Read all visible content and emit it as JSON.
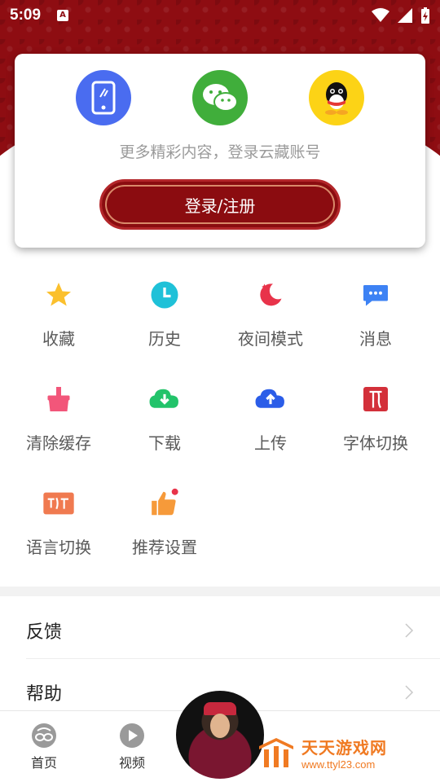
{
  "status_bar": {
    "time": "5:09",
    "app_badge": "A"
  },
  "login": {
    "hint": "更多精彩内容，登录云藏账号",
    "button_label": "登录/注册",
    "methods": [
      "phone-icon",
      "wechat-icon",
      "qq-icon"
    ]
  },
  "grid": [
    {
      "label": "收藏",
      "icon": "star-icon",
      "color": "#fbc02d"
    },
    {
      "label": "历史",
      "icon": "clock-icon",
      "color": "#1fc1d8"
    },
    {
      "label": "夜间模式",
      "icon": "moon-icon",
      "color": "#e8334a"
    },
    {
      "label": "消息",
      "icon": "message-icon",
      "color": "#3d82f4"
    },
    {
      "label": "清除缓存",
      "icon": "broom-icon",
      "color": "#f2567a"
    },
    {
      "label": "下载",
      "icon": "cloud-download-icon",
      "color": "#22c36a"
    },
    {
      "label": "上传",
      "icon": "cloud-upload-icon",
      "color": "#2b5de8"
    },
    {
      "label": "字体切换",
      "icon": "font-icon",
      "color": "#d3303a"
    },
    {
      "label": "语言切换",
      "icon": "language-icon",
      "color": "#f07a50"
    },
    {
      "label": "推荐设置",
      "icon": "thumbs-up-icon",
      "color": "#f69a3a"
    }
  ],
  "list": {
    "feedback": "反馈",
    "help": "帮助"
  },
  "bottom_nav": {
    "home": "首页",
    "video": "视频"
  },
  "watermark": {
    "title": "天天游戏网",
    "url": "www.ttyl23.com"
  },
  "colors": {
    "brand_red": "#8e0d12",
    "login_button": "#8b0c10",
    "watermark": "#f07a22"
  }
}
